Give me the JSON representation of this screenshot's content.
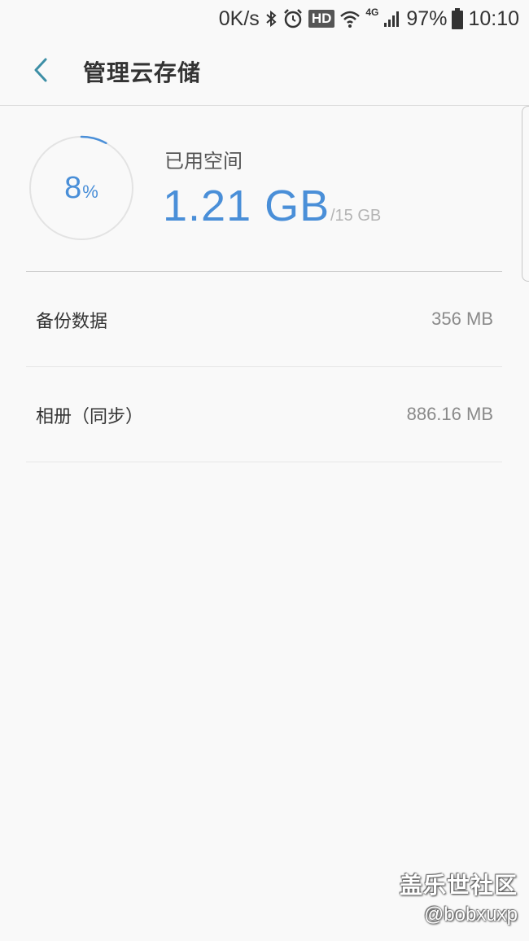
{
  "status_bar": {
    "net_speed": "0K/s",
    "hd_badge": "HD",
    "network_type": "4G",
    "battery": "97%",
    "time": "10:10",
    "icons": [
      "bluetooth-icon",
      "alarm-icon",
      "wifi-icon",
      "signal-icon",
      "battery-icon"
    ]
  },
  "header": {
    "title": "管理云存储",
    "back_icon": "chevron-left-icon"
  },
  "usage": {
    "percent_value": "8",
    "percent_sign": "%",
    "percent_fraction": 0.08,
    "label": "已用空间",
    "used": "1.21 GB",
    "total": "/15 GB"
  },
  "items": [
    {
      "label": "备份数据",
      "value": "356 MB"
    },
    {
      "label": "相册（同步）",
      "value": "886.16 MB"
    }
  ],
  "watermark": {
    "title": "盖乐世社区",
    "handle": "@bobxuxp"
  },
  "colors": {
    "accent": "#4a8fd8",
    "background": "#f9f9f9",
    "ring_track": "#e3e3e3"
  }
}
